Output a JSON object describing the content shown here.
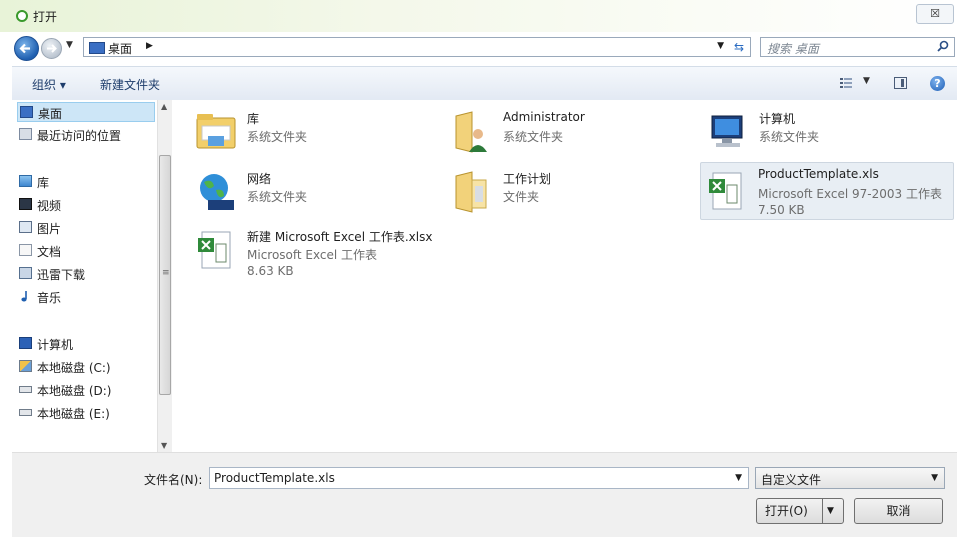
{
  "window": {
    "title": "打开",
    "close_symbol": "☒"
  },
  "address_bar": {
    "path": "桌面",
    "search_placeholder": "搜索 桌面"
  },
  "toolbar": {
    "organize": "组织 ▾",
    "new_folder": "新建文件夹",
    "help": "?"
  },
  "sidebar": {
    "items": [
      {
        "label": "桌面",
        "icon": "desktop-icon"
      },
      {
        "label": "最近访问的位置",
        "icon": "recent-places-icon"
      },
      {
        "label": "库",
        "icon": "library-icon"
      },
      {
        "label": "视频",
        "icon": "video-icon"
      },
      {
        "label": "图片",
        "icon": "picture-icon"
      },
      {
        "label": "文档",
        "icon": "document-icon"
      },
      {
        "label": "迅雷下载",
        "icon": "download-icon"
      },
      {
        "label": "音乐",
        "icon": "music-icon"
      },
      {
        "label": "计算机",
        "icon": "computer-icon"
      },
      {
        "label": "本地磁盘 (C:)",
        "icon": "drive-c-icon"
      },
      {
        "label": "本地磁盘 (D:)",
        "icon": "drive-icon"
      },
      {
        "label": "本地磁盘 (E:)",
        "icon": "drive-icon"
      }
    ]
  },
  "files": [
    {
      "name": "库",
      "type": "系统文件夹",
      "size": ""
    },
    {
      "name": "Administrator",
      "type": "系统文件夹",
      "size": ""
    },
    {
      "name": "计算机",
      "type": "系统文件夹",
      "size": ""
    },
    {
      "name": "网络",
      "type": "系统文件夹",
      "size": ""
    },
    {
      "name": "工作计划",
      "type": "文件夹",
      "size": ""
    },
    {
      "name": "ProductTemplate.xls",
      "type": "Microsoft Excel 97-2003 工作表",
      "size": "7.50 KB"
    },
    {
      "name": "新建 Microsoft Excel 工作表.xlsx",
      "type": "Microsoft Excel 工作表",
      "size": "8.63 KB"
    }
  ],
  "bottom": {
    "filename_label": "文件名(N):",
    "filename_value": "ProductTemplate.xls",
    "filter_value": "自定义文件",
    "open_button": "打开(O)",
    "cancel_button": "取消"
  }
}
